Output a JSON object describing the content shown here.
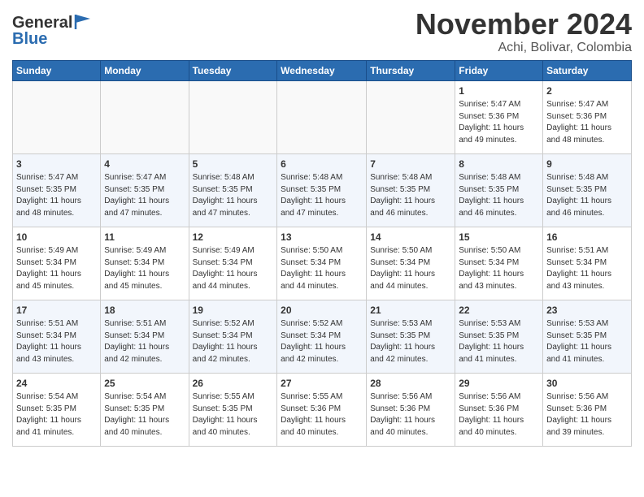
{
  "header": {
    "logo_general": "General",
    "logo_blue": "Blue",
    "title": "November 2024",
    "subtitle": "Achi, Bolivar, Colombia"
  },
  "calendar": {
    "days_of_week": [
      "Sunday",
      "Monday",
      "Tuesday",
      "Wednesday",
      "Thursday",
      "Friday",
      "Saturday"
    ],
    "weeks": [
      [
        {
          "day": "",
          "info": ""
        },
        {
          "day": "",
          "info": ""
        },
        {
          "day": "",
          "info": ""
        },
        {
          "day": "",
          "info": ""
        },
        {
          "day": "",
          "info": ""
        },
        {
          "day": "1",
          "info": "Sunrise: 5:47 AM\nSunset: 5:36 PM\nDaylight: 11 hours\nand 49 minutes."
        },
        {
          "day": "2",
          "info": "Sunrise: 5:47 AM\nSunset: 5:36 PM\nDaylight: 11 hours\nand 48 minutes."
        }
      ],
      [
        {
          "day": "3",
          "info": "Sunrise: 5:47 AM\nSunset: 5:35 PM\nDaylight: 11 hours\nand 48 minutes."
        },
        {
          "day": "4",
          "info": "Sunrise: 5:47 AM\nSunset: 5:35 PM\nDaylight: 11 hours\nand 47 minutes."
        },
        {
          "day": "5",
          "info": "Sunrise: 5:48 AM\nSunset: 5:35 PM\nDaylight: 11 hours\nand 47 minutes."
        },
        {
          "day": "6",
          "info": "Sunrise: 5:48 AM\nSunset: 5:35 PM\nDaylight: 11 hours\nand 47 minutes."
        },
        {
          "day": "7",
          "info": "Sunrise: 5:48 AM\nSunset: 5:35 PM\nDaylight: 11 hours\nand 46 minutes."
        },
        {
          "day": "8",
          "info": "Sunrise: 5:48 AM\nSunset: 5:35 PM\nDaylight: 11 hours\nand 46 minutes."
        },
        {
          "day": "9",
          "info": "Sunrise: 5:48 AM\nSunset: 5:35 PM\nDaylight: 11 hours\nand 46 minutes."
        }
      ],
      [
        {
          "day": "10",
          "info": "Sunrise: 5:49 AM\nSunset: 5:34 PM\nDaylight: 11 hours\nand 45 minutes."
        },
        {
          "day": "11",
          "info": "Sunrise: 5:49 AM\nSunset: 5:34 PM\nDaylight: 11 hours\nand 45 minutes."
        },
        {
          "day": "12",
          "info": "Sunrise: 5:49 AM\nSunset: 5:34 PM\nDaylight: 11 hours\nand 44 minutes."
        },
        {
          "day": "13",
          "info": "Sunrise: 5:50 AM\nSunset: 5:34 PM\nDaylight: 11 hours\nand 44 minutes."
        },
        {
          "day": "14",
          "info": "Sunrise: 5:50 AM\nSunset: 5:34 PM\nDaylight: 11 hours\nand 44 minutes."
        },
        {
          "day": "15",
          "info": "Sunrise: 5:50 AM\nSunset: 5:34 PM\nDaylight: 11 hours\nand 43 minutes."
        },
        {
          "day": "16",
          "info": "Sunrise: 5:51 AM\nSunset: 5:34 PM\nDaylight: 11 hours\nand 43 minutes."
        }
      ],
      [
        {
          "day": "17",
          "info": "Sunrise: 5:51 AM\nSunset: 5:34 PM\nDaylight: 11 hours\nand 43 minutes."
        },
        {
          "day": "18",
          "info": "Sunrise: 5:51 AM\nSunset: 5:34 PM\nDaylight: 11 hours\nand 42 minutes."
        },
        {
          "day": "19",
          "info": "Sunrise: 5:52 AM\nSunset: 5:34 PM\nDaylight: 11 hours\nand 42 minutes."
        },
        {
          "day": "20",
          "info": "Sunrise: 5:52 AM\nSunset: 5:34 PM\nDaylight: 11 hours\nand 42 minutes."
        },
        {
          "day": "21",
          "info": "Sunrise: 5:53 AM\nSunset: 5:35 PM\nDaylight: 11 hours\nand 42 minutes."
        },
        {
          "day": "22",
          "info": "Sunrise: 5:53 AM\nSunset: 5:35 PM\nDaylight: 11 hours\nand 41 minutes."
        },
        {
          "day": "23",
          "info": "Sunrise: 5:53 AM\nSunset: 5:35 PM\nDaylight: 11 hours\nand 41 minutes."
        }
      ],
      [
        {
          "day": "24",
          "info": "Sunrise: 5:54 AM\nSunset: 5:35 PM\nDaylight: 11 hours\nand 41 minutes."
        },
        {
          "day": "25",
          "info": "Sunrise: 5:54 AM\nSunset: 5:35 PM\nDaylight: 11 hours\nand 40 minutes."
        },
        {
          "day": "26",
          "info": "Sunrise: 5:55 AM\nSunset: 5:35 PM\nDaylight: 11 hours\nand 40 minutes."
        },
        {
          "day": "27",
          "info": "Sunrise: 5:55 AM\nSunset: 5:36 PM\nDaylight: 11 hours\nand 40 minutes."
        },
        {
          "day": "28",
          "info": "Sunrise: 5:56 AM\nSunset: 5:36 PM\nDaylight: 11 hours\nand 40 minutes."
        },
        {
          "day": "29",
          "info": "Sunrise: 5:56 AM\nSunset: 5:36 PM\nDaylight: 11 hours\nand 40 minutes."
        },
        {
          "day": "30",
          "info": "Sunrise: 5:56 AM\nSunset: 5:36 PM\nDaylight: 11 hours\nand 39 minutes."
        }
      ]
    ]
  }
}
